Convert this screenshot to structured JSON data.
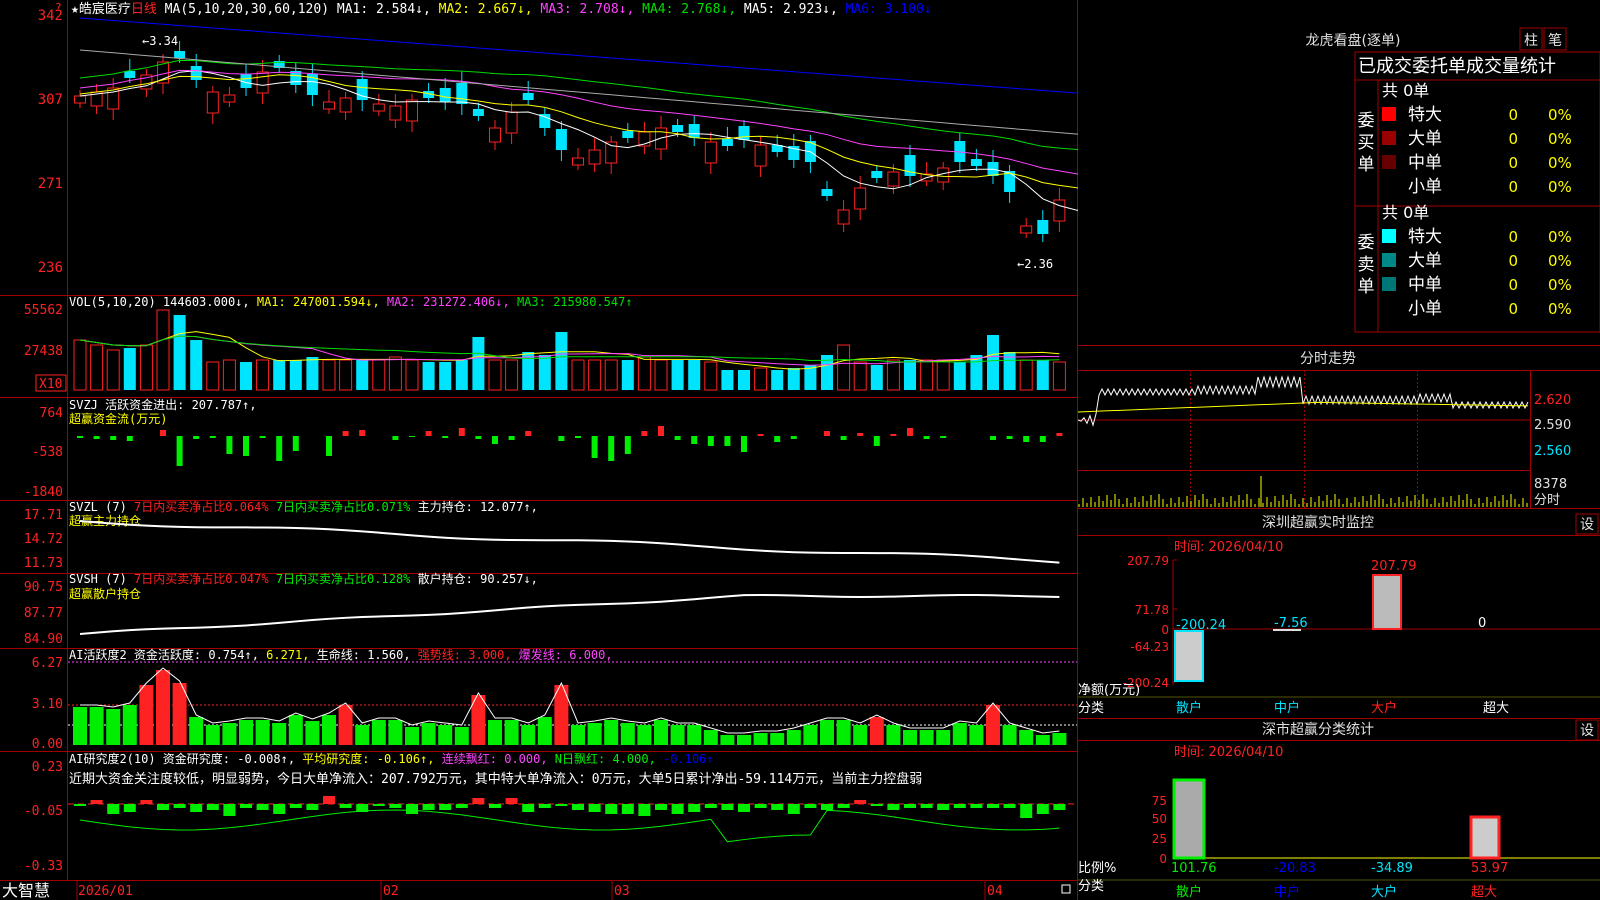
{
  "colors": {
    "up": "#ff2222",
    "down": "#00e5ff",
    "grid": "#a00000",
    "ma1": "#ffffff",
    "ma2": "#ffff00",
    "ma3": "#ff44ff",
    "ma4": "#00dd00",
    "ma5": "#aaaaaa",
    "ma6": "#0000ff",
    "green": "#00ee00",
    "yellow": "#ffff00",
    "magenta": "#ff44ff"
  },
  "main": {
    "title": "★皓宸医疗",
    "period": "日线",
    "ma_text": [
      {
        "t": "MA(5,10,20,30,60,120)",
        "c": "#ffffff"
      },
      {
        "t": " MA1: 2.584↓,",
        "c": "#ffffff"
      },
      {
        "t": " MA2: 2.667↓,",
        "c": "#ffff00"
      },
      {
        "t": " MA3: 2.708↓,",
        "c": "#ff44ff"
      },
      {
        "t": " MA4: 2.768↓,",
        "c": "#00dd00"
      },
      {
        "t": " MA5: 2.923↓,",
        "c": "#ffffff"
      },
      {
        "t": " MA6: 3.100↓",
        "c": "#0000ff"
      }
    ],
    "y_labels": [
      "342",
      "307",
      "271",
      "236"
    ],
    "high_label": "3.34",
    "low_label": "2.36"
  },
  "vol": {
    "parts": [
      {
        "t": "VOL(5,10,20)",
        "c": "#ffffff"
      },
      {
        "t": " 144603.000↓,",
        "c": "#ffffff"
      },
      {
        "t": " MA1: 247001.594↓,",
        "c": "#ffff00"
      },
      {
        "t": " MA2: 231272.406↓,",
        "c": "#ff44ff"
      },
      {
        "t": " MA3: 215980.547↑",
        "c": "#00dd00"
      }
    ],
    "y_labels": [
      "55562",
      "27438"
    ],
    "unit": "X10"
  },
  "svzj": {
    "parts": [
      {
        "t": "SVZJ  活跃资金进出: 207.787↑,",
        "c": "#ffffff"
      }
    ],
    "line2": "超赢资金流(万元)",
    "y_labels": [
      "764",
      "-538",
      "-1840"
    ]
  },
  "svzl": {
    "parts": [
      {
        "t": "SVZL (7)",
        "c": "#ffffff"
      },
      {
        "t": " 7日内买卖净占比0.064%",
        "c": "#ff2222"
      },
      {
        "t": " 7日内买卖净占比0.071%",
        "c": "#00ee00"
      },
      {
        "t": " 主力持仓: 12.077↑,",
        "c": "#ffffff"
      }
    ],
    "line2": "超赢主力持仓",
    "y_labels": [
      "17.71",
      "14.72",
      "11.73"
    ]
  },
  "svsh": {
    "parts": [
      {
        "t": "SVSH (7)",
        "c": "#ffffff"
      },
      {
        "t": " 7日内买卖净占比0.047%",
        "c": "#ff2222"
      },
      {
        "t": " 7日内买卖净占比0.128%",
        "c": "#00ee00"
      },
      {
        "t": " 散户持仓: 90.257↓,",
        "c": "#ffffff"
      }
    ],
    "line2": "超赢散户持仓",
    "y_labels": [
      "90.75",
      "87.77",
      "84.90"
    ]
  },
  "ai1": {
    "parts": [
      {
        "t": "AI活跃度2",
        "c": "#ffffff"
      },
      {
        "t": " 资金活跃度: 0.754↑,",
        "c": "#ffffff"
      },
      {
        "t": " 6.271,",
        "c": "#ffff00"
      },
      {
        "t": " 生命线: 1.560,",
        "c": "#ffffff"
      },
      {
        "t": " 强势线: 3.000,",
        "c": "#ff2222"
      },
      {
        "t": " 爆发线: 6.000,",
        "c": "#ff44ff"
      }
    ],
    "y_labels": [
      "6.27",
      "3.10",
      "0.00"
    ]
  },
  "ai2": {
    "parts": [
      {
        "t": "AI研究度2(10)",
        "c": "#ffffff"
      },
      {
        "t": " 资金研究度: -0.008↑,",
        "c": "#ffffff"
      },
      {
        "t": " 平均研究度: -0.106↑,",
        "c": "#ffff00"
      },
      {
        "t": " 连续飘红: 0.000,",
        "c": "#ff44ff"
      },
      {
        "t": " N日飘红: 4.000,",
        "c": "#00ee00"
      },
      {
        "t": " -0.106↑",
        "c": "#0000ff"
      }
    ],
    "comment": "近期大资金关注度较低，明显弱势，今日大单净流入：207.792万元，其中特大单净流入：0万元，大单5日累计净出-59.114万元，当前主力控盘弱",
    "y_labels": [
      "0.23",
      "-0.05",
      "-0.33"
    ]
  },
  "bottom": {
    "logo": "大智慧",
    "dates": [
      "2026/01",
      "02",
      "03",
      "04"
    ]
  },
  "right": {
    "dragon": {
      "title": "龙虎看盘(逐单)",
      "btn1": "柱",
      "btn2": "笔",
      "subtitle": "已成交委托单成交量统计",
      "buy": {
        "label": "委买单",
        "total": "共 0单",
        "rows": [
          {
            "name": "特大",
            "v": "0",
            "p": "0%",
            "color": "#ff0000"
          },
          {
            "name": "大单",
            "v": "0",
            "p": "0%",
            "color": "#990000"
          },
          {
            "name": "中单",
            "v": "0",
            "p": "0%",
            "color": "#660000"
          },
          {
            "name": "小单",
            "v": "0",
            "p": "0%",
            "color": ""
          }
        ]
      },
      "sell": {
        "label": "委卖单",
        "total": "共 0单",
        "rows": [
          {
            "name": "特大",
            "v": "0",
            "p": "0%",
            "color": "#00ffff"
          },
          {
            "name": "大单",
            "v": "0",
            "p": "0%",
            "color": "#008888"
          },
          {
            "name": "中单",
            "v": "0",
            "p": "0%",
            "color": "#007777"
          },
          {
            "name": "小单",
            "v": "0",
            "p": "0%",
            "color": ""
          }
        ]
      }
    },
    "intraday": {
      "title": "分时走势",
      "y_labels": [
        "2.620",
        "2.590",
        "2.560"
      ],
      "vol_label": "8378",
      "vol_sub": "分时"
    },
    "sz_monitor": {
      "title": "深圳超赢实时监控",
      "btn": "设",
      "time_label": "时间: 2026/04/10",
      "y_labels": [
        "207.79",
        "71.78",
        "0",
        "-64.23",
        "-200.24"
      ],
      "values": {
        "retail": "-200.24",
        "mid": "-7.56",
        "big": "207.79",
        "super": "0"
      },
      "y_title": "净额(万元)",
      "x_title": "分类",
      "cats": [
        "散户",
        "中户",
        "大户",
        "超大"
      ]
    },
    "sz_class": {
      "title": "深市超赢分类统计",
      "btn": "设",
      "time_label": "时间: 2026/04/10",
      "y_labels": [
        "75",
        "50",
        "25",
        "0"
      ],
      "values": {
        "retail": "101.76",
        "mid": "-20.83",
        "big": "-34.89",
        "super": "53.97"
      },
      "y_title": "比例%",
      "x_title": "分类",
      "cats": [
        "散户",
        "中户",
        "大户",
        "超大"
      ]
    }
  }
}
